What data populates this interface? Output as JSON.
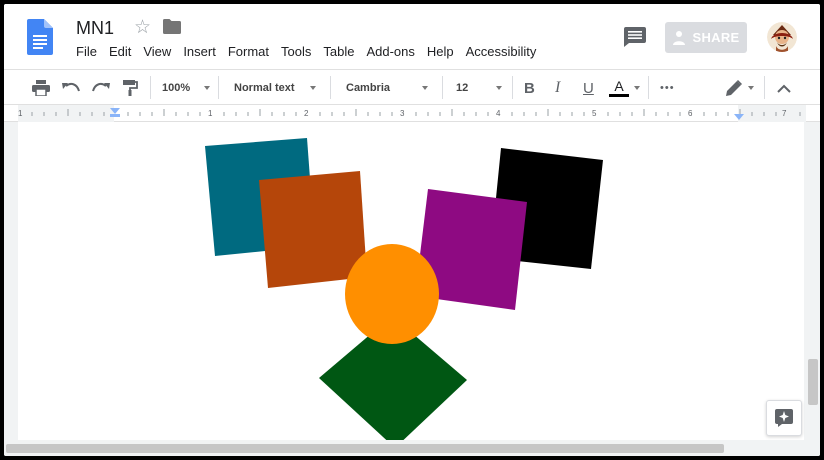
{
  "document": {
    "title": "MN1"
  },
  "menu": {
    "items": [
      "File",
      "Edit",
      "View",
      "Insert",
      "Format",
      "Tools",
      "Table",
      "Add-ons",
      "Help",
      "Accessibility"
    ]
  },
  "share": {
    "label": "SHARE"
  },
  "toolbar": {
    "zoom": "100%",
    "paragraph_style": "Normal text",
    "font": "Cambria",
    "font_size": "12",
    "bold_label": "B",
    "italic_label": "I",
    "underline_label": "U",
    "text_color_label": "A",
    "more_label": "•••"
  },
  "ruler": {
    "labels": [
      "1",
      "1",
      "2",
      "3",
      "4",
      "5",
      "6",
      "7"
    ]
  },
  "colors": {
    "accent_blue": "#4285f4",
    "teal_square": "#006a80",
    "rust_square": "#b5460a",
    "black_square": "#000000",
    "purple_square": "#8e0a82",
    "orange_circle": "#ff8f00",
    "green_diamond": "#005713"
  },
  "drawing": {
    "shapes": [
      "teal-square",
      "rust-square",
      "black-square",
      "purple-square",
      "orange-circle",
      "green-diamond"
    ]
  }
}
